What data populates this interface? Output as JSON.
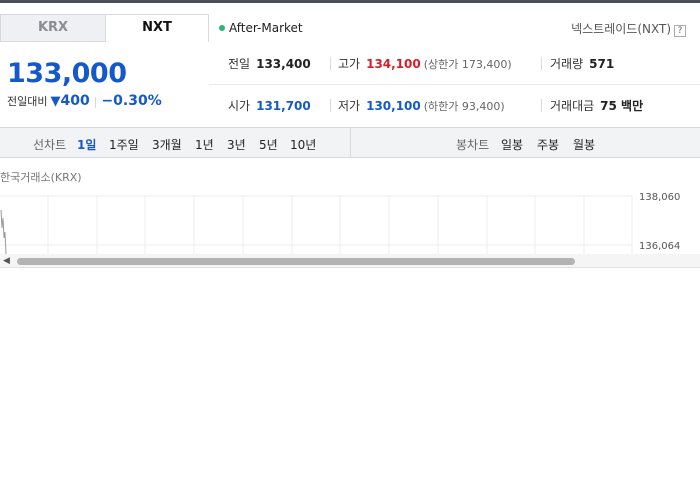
{
  "tabs": {
    "krx": "KRX",
    "nxt": "NXT"
  },
  "session_label": "After-Market",
  "provider_label": "넥스트레이드(NXT)",
  "help_glyph": "?",
  "price": {
    "current": "133,000",
    "change_label": "전일대비",
    "change_direction_icon": "down-triangle-icon",
    "change_amount": "400",
    "change_percent": "−0.30%"
  },
  "stats": {
    "prev_close": {
      "label": "전일",
      "value": "133,400"
    },
    "high": {
      "label": "고가",
      "value": "134,100",
      "limit": "(상한가 173,400)"
    },
    "volume": {
      "label": "거래량",
      "value": "571"
    },
    "open": {
      "label": "시가",
      "value": "131,700"
    },
    "low": {
      "label": "저가",
      "value": "130,100",
      "limit": "(하한가 93,400)"
    },
    "amount": {
      "label": "거래대금",
      "value": "75 백만"
    }
  },
  "line_chart": {
    "label": "선차트",
    "options": [
      "1일",
      "1주일",
      "3개월",
      "1년",
      "3년",
      "5년",
      "10년"
    ],
    "active": "1일"
  },
  "candle_chart": {
    "label": "봉차트",
    "options": [
      "일봉",
      "주봉",
      "월봉"
    ]
  },
  "chart_caption": "한국거래소(KRX)",
  "chart_axis": {
    "ticks": [
      "138,060",
      "136,064"
    ]
  },
  "colors": {
    "up": "#d2202a",
    "down": "#1559c8",
    "session_dot": "#2bb673"
  }
}
